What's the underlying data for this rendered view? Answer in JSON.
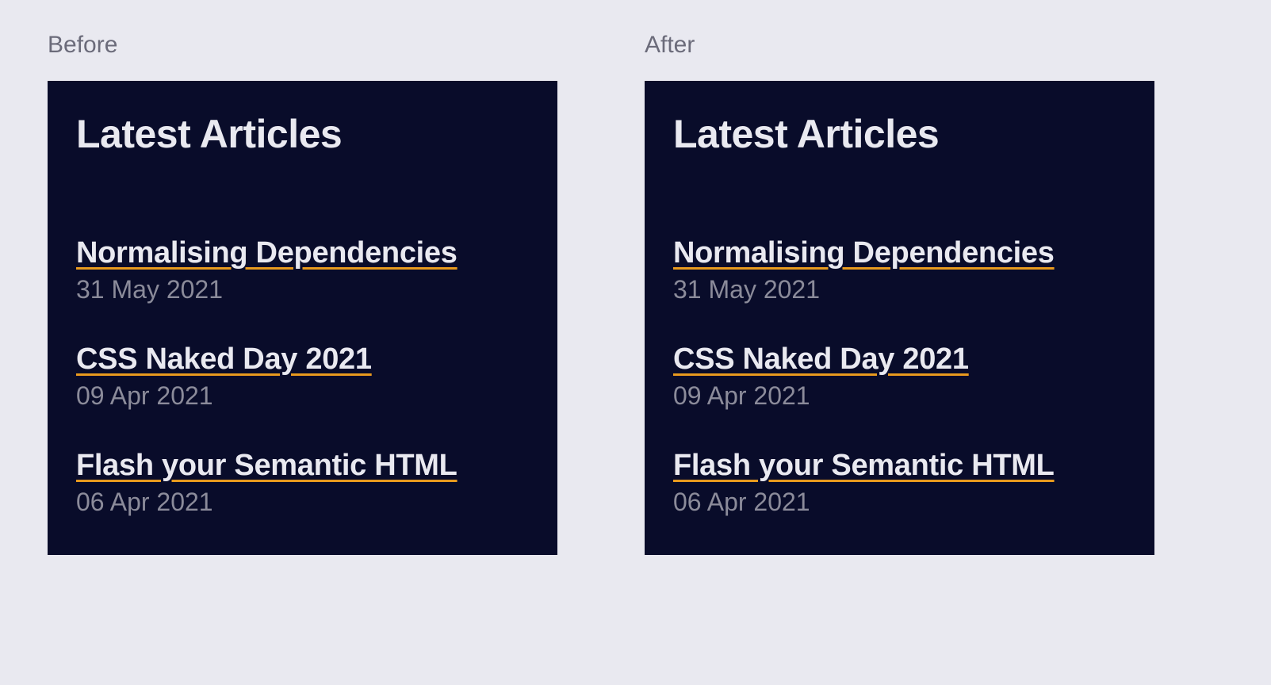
{
  "before": {
    "label": "Before",
    "title": "Latest Articles",
    "articles": [
      {
        "title": "Normalising Dependencies",
        "date": "31 May 2021"
      },
      {
        "title": "CSS Naked Day 2021",
        "date": "09 Apr 2021"
      },
      {
        "title": "Flash your Semantic HTML",
        "date": "06 Apr 2021"
      }
    ]
  },
  "after": {
    "label": "After",
    "title": "Latest Articles",
    "articles": [
      {
        "title": "Normalising Dependencies",
        "date": "31 May 2021"
      },
      {
        "title": "CSS Naked Day 2021",
        "date": "09 Apr 2021"
      },
      {
        "title": "Flash your Semantic HTML",
        "date": "06 Apr 2021"
      }
    ]
  }
}
